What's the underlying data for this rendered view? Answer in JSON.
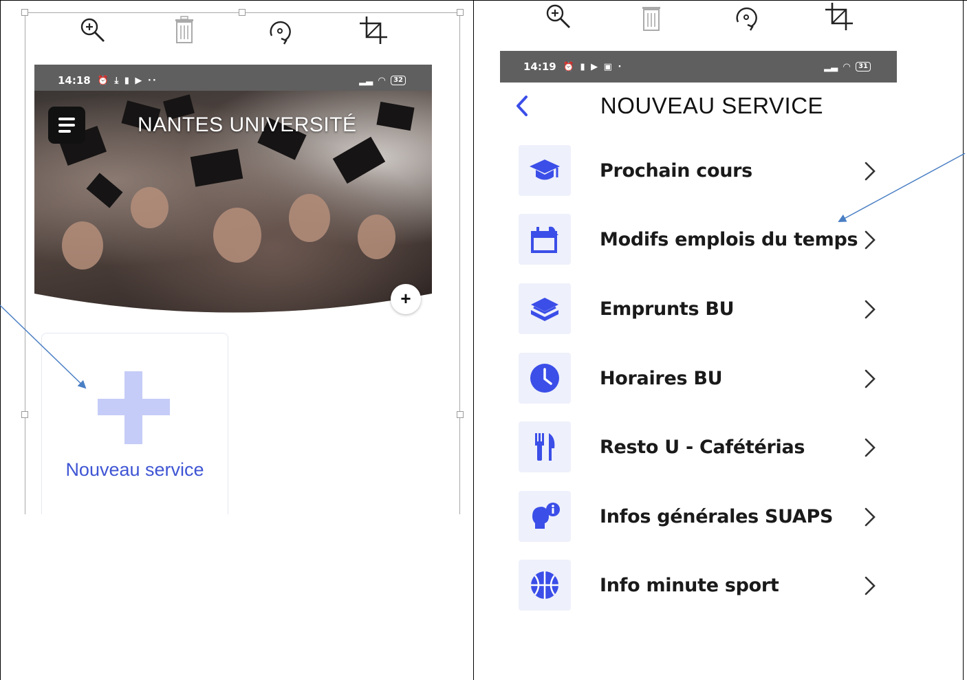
{
  "left_phone": {
    "status": {
      "time": "14:18",
      "icons": "⏰ ⤓ ▮ ▶ ··",
      "battery": "32"
    },
    "header_title": "NANTES UNIVERSITÉ",
    "add_tile_label": "Nouveau service"
  },
  "right_phone": {
    "status": {
      "time": "14:19",
      "icons": "⏰ ▮ ▶ ▣ ·",
      "battery": "31"
    },
    "header_title": "NOUVEAU SERVICE",
    "services": [
      {
        "label": "Prochain cours",
        "icon": "graduation-cap-icon"
      },
      {
        "label": "Modifs emplois du temps",
        "icon": "calendar-icon"
      },
      {
        "label": "Emprunts BU",
        "icon": "books-icon"
      },
      {
        "label": "Horaires BU",
        "icon": "clock-icon"
      },
      {
        "label": "Resto U - Cafétérias",
        "icon": "fork-knife-icon"
      },
      {
        "label": "Infos générales SUAPS",
        "icon": "info-person-icon"
      },
      {
        "label": "Info minute sport",
        "icon": "basketball-icon"
      }
    ]
  },
  "image_toolbar": [
    "zoom-in-icon",
    "trash-icon",
    "rotate-icon",
    "crop-icon"
  ],
  "colors": {
    "accent": "#3f55d4",
    "icon_blue": "#3b4ee8",
    "icon_bg": "#eef0fb",
    "plus_light": "#c5ccf7",
    "statusbar": "#5f5f5f",
    "annotation_arrow": "#4a7fc4"
  }
}
